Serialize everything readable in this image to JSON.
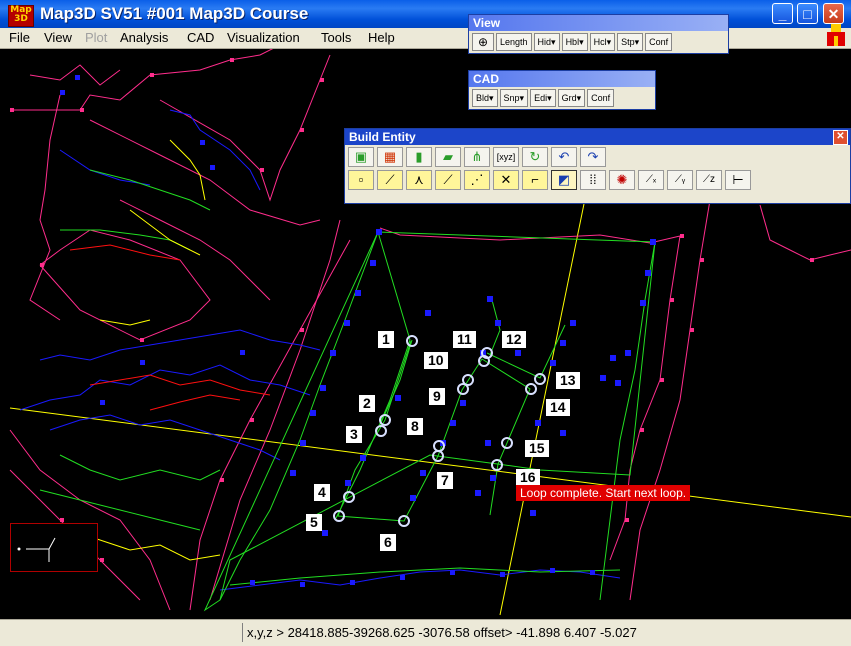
{
  "window": {
    "title": "Map3D SV51 #001  Map3D Course",
    "app_icon_text": "Map 3D",
    "minimize": "_",
    "maximize": "□",
    "close": "✕"
  },
  "menu": [
    "File",
    "View",
    "Plot",
    "Analysis",
    "CAD",
    "Visualization",
    "Tools",
    "Help"
  ],
  "menu_disabled": "Plot",
  "toolbars": {
    "view": {
      "title": "View",
      "buttons": [
        "⊕",
        "Length",
        "Hid▾",
        "Hbl▾",
        "Hcl▾",
        "Stp▾",
        "Conf"
      ]
    },
    "cad": {
      "title": "CAD",
      "buttons": [
        "Bld▾",
        "Snp▾",
        "Edi▾",
        "Grd▾",
        "Conf"
      ]
    },
    "build_entity": {
      "title": "Build Entity",
      "close": "✕",
      "row1_icons": [
        "cube-icon",
        "surface-icon",
        "plane-icon",
        "line-feature-icon",
        "multi-line-icon",
        "xyz-entry-icon",
        "rotate-arrow-icon",
        "undo-icon",
        "redo-icon"
      ],
      "row1_glyphs": [
        "▣",
        "▦",
        "▮",
        "▰",
        "⋔",
        "[xyz]",
        "↻",
        "↶",
        "↷"
      ],
      "row2_icons": [
        "point-icon",
        "line-segment-icon",
        "angle-icon",
        "line-icon",
        "dashed-line-icon",
        "intersect-icon",
        "curve-icon",
        "close-loop-icon",
        "grid-points-icon",
        "target-icon",
        "slope-x-icon",
        "slope-y-icon",
        "slope-z-icon",
        "axis-icon"
      ],
      "row2_glyphs": [
        "▫",
        "⟋",
        "⋏",
        "⟋",
        "⋰",
        "✕",
        "⌐",
        "◩",
        "⁞⁞",
        "✺",
        "⟋ₓ",
        "⟋ᵧ",
        "⟋z",
        "⊢"
      ]
    }
  },
  "labels": [
    "1",
    "2",
    "3",
    "4",
    "5",
    "6",
    "7",
    "8",
    "9",
    "10",
    "11",
    "12",
    "13",
    "14",
    "15",
    "16"
  ],
  "status_message": "Loop complete. Start next loop.",
  "coordinates": "x,y,z >  28418.885-39268.625 -3076.58 offset>     -41.898      6.407    -5.027",
  "colors": {
    "title_bar": "#0054e3",
    "magenta_lines": "#ff2d8c",
    "blue_points": "#1a1aff",
    "green_lines": "#22dd22",
    "yellow_lines": "#ffff00",
    "red_lines": "#ff1010",
    "status_message_bg": "#e00000"
  }
}
